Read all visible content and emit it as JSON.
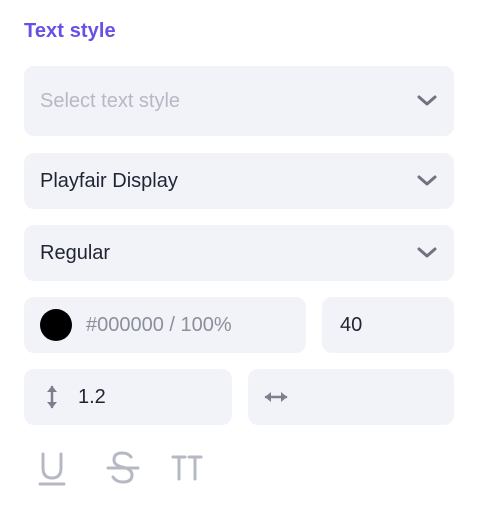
{
  "panel": {
    "title": "Text style"
  },
  "style_select": {
    "placeholder": "Select text style",
    "icon": "chevron-down-icon"
  },
  "font_family": {
    "value": "Playfair Display",
    "icon": "chevron-down-icon"
  },
  "font_weight": {
    "value": "Regular",
    "icon": "chevron-down-icon"
  },
  "color": {
    "swatch": "#000000",
    "value": "#000000 / 100%"
  },
  "font_size": {
    "value": "40"
  },
  "line_height": {
    "icon": "vertical-arrows-icon",
    "value": "1.2"
  },
  "letter_spacing": {
    "icon": "horizontal-arrows-icon",
    "value": ""
  },
  "decorations": [
    {
      "name": "underline-icon"
    },
    {
      "name": "strikethrough-icon"
    },
    {
      "name": "uppercase-icon"
    }
  ],
  "colors": {
    "accent": "#6a4ee6",
    "field_bg": "#f2f3f8",
    "icon": "#7d808c",
    "icon_muted": "#b6b9c4"
  }
}
